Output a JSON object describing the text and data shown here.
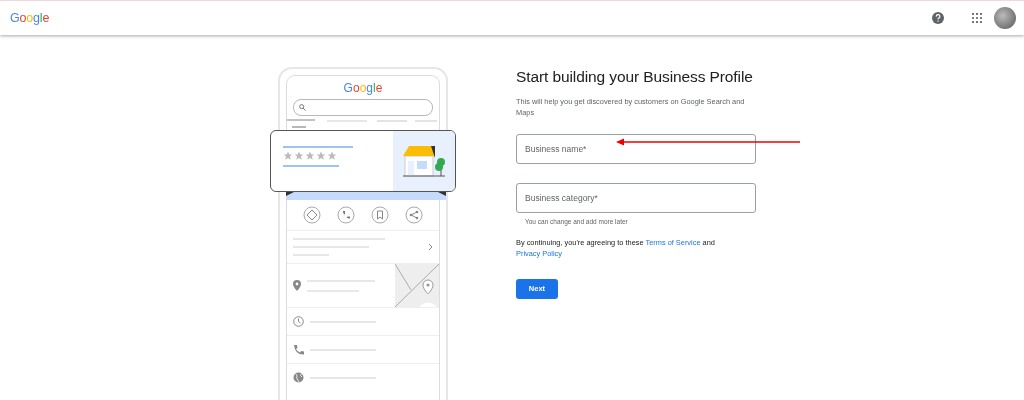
{
  "header": {
    "logo": "Google"
  },
  "illustration": {
    "logo": "Google"
  },
  "form": {
    "title": "Start building your Business Profile",
    "subtitle": "This will help you get discovered by customers on Google Search and Maps",
    "fields": [
      {
        "placeholder": "Business name*"
      },
      {
        "placeholder": "Business category*",
        "helper": "You can change and add more later"
      }
    ],
    "consent": [
      {
        "kind": "text",
        "text": "By continuing, you're agreeing to these "
      },
      {
        "kind": "link",
        "text": "Terms of Service"
      },
      {
        "kind": "text",
        "text": " and "
      },
      {
        "kind": "link",
        "text": "Privacy Policy"
      }
    ],
    "button": "Next"
  }
}
